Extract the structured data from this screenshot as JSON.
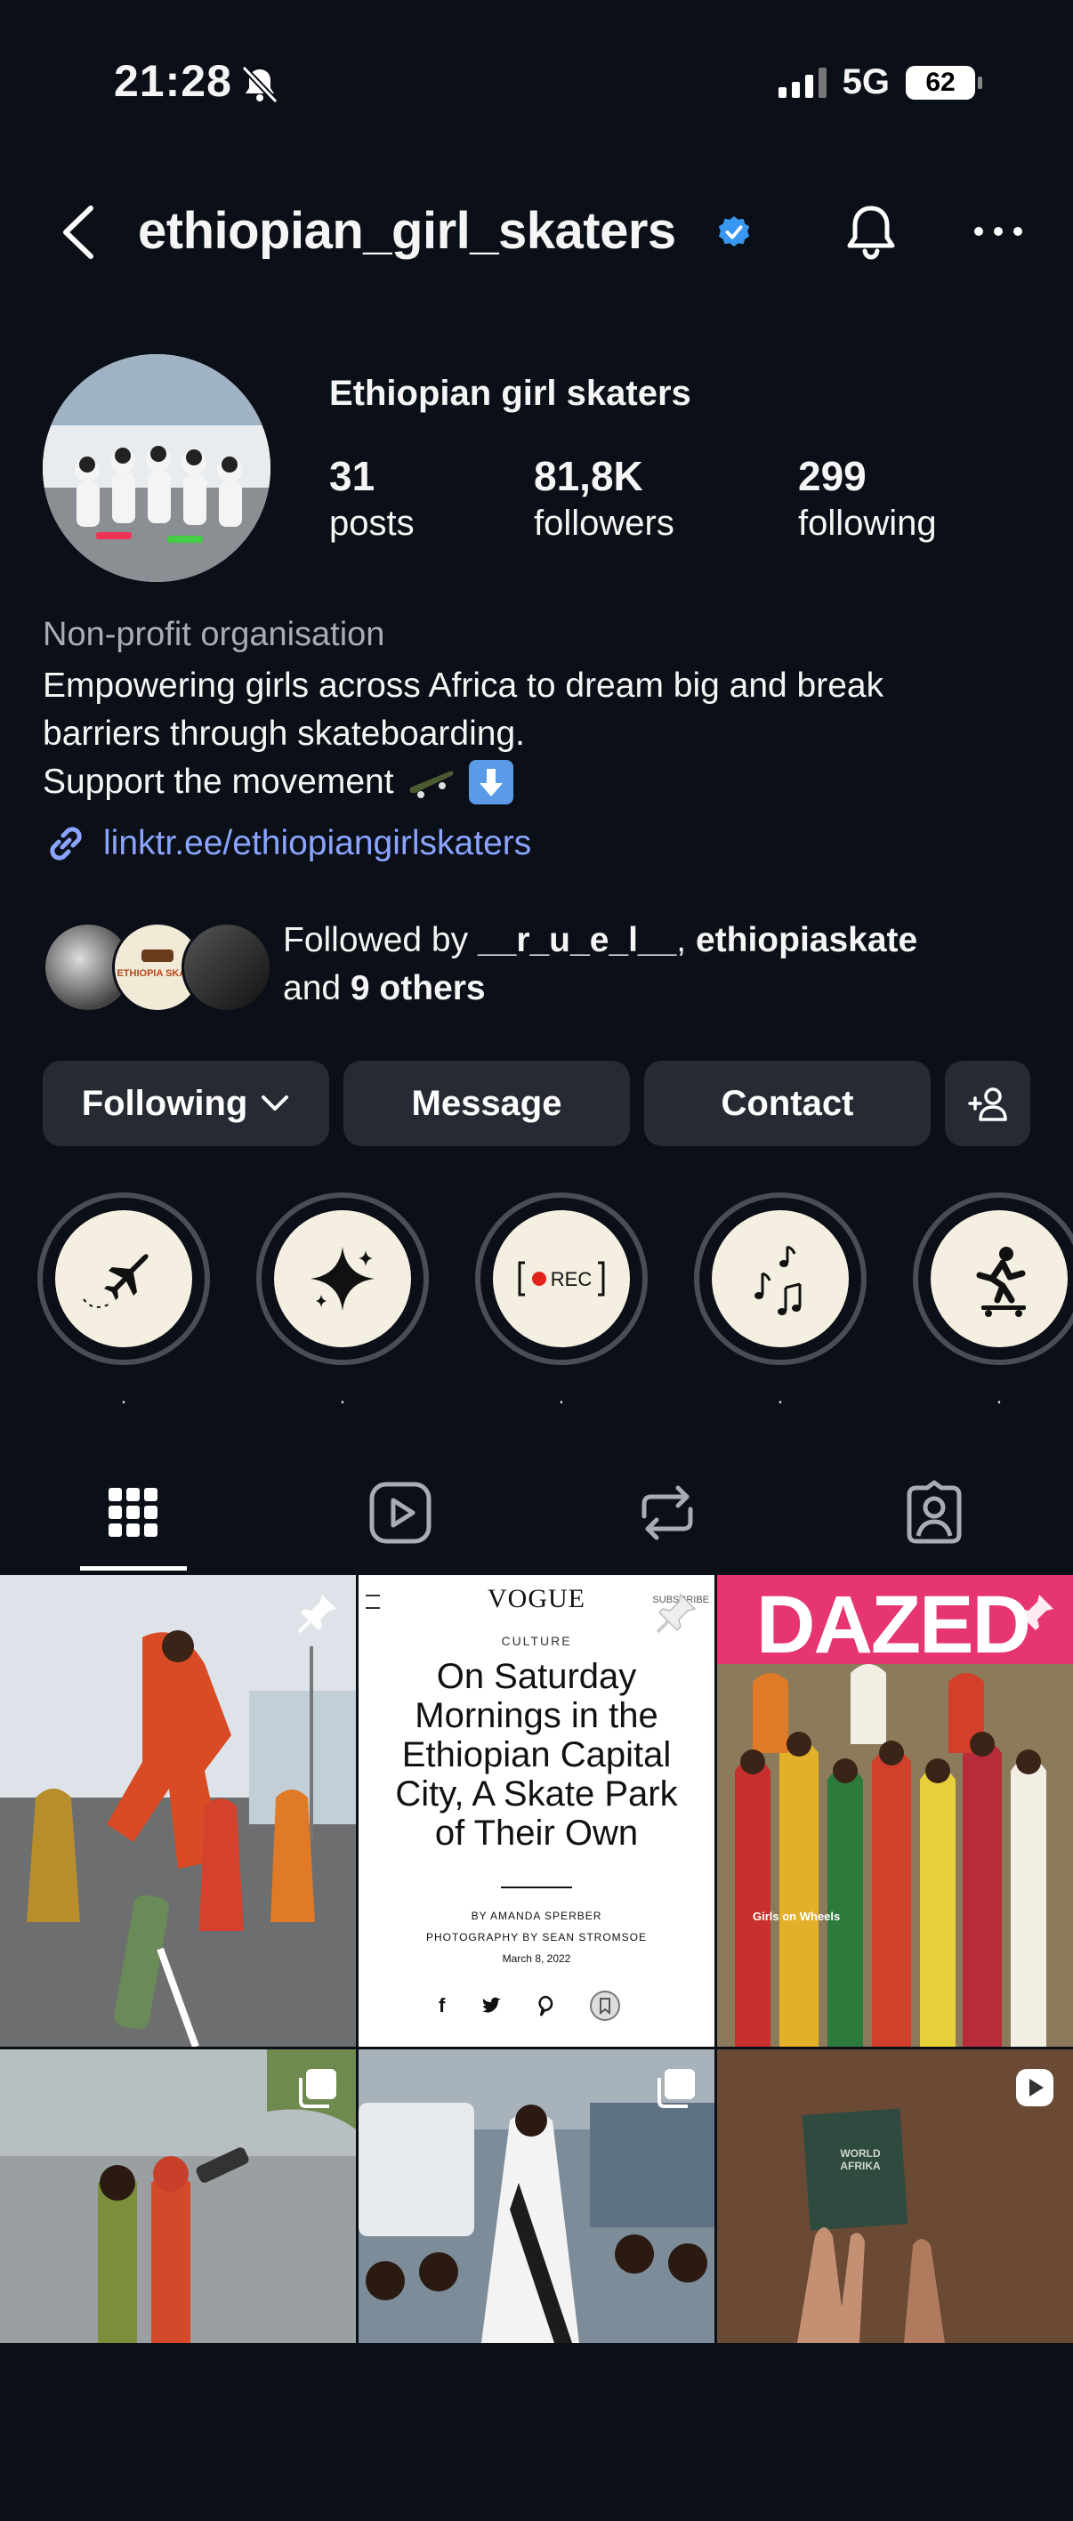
{
  "status_bar": {
    "time": "21:28",
    "network": "5G",
    "battery": "62"
  },
  "header": {
    "username": "ethiopian_girl_skaters"
  },
  "profile": {
    "display_name": "Ethiopian girl skaters",
    "stats": [
      {
        "value": "31",
        "label": "posts"
      },
      {
        "value": "81,8K",
        "label": "followers"
      },
      {
        "value": "299",
        "label": "following"
      }
    ],
    "category": "Non-profit organisation",
    "bio_line1": "Empowering girls across Africa to dream big and break",
    "bio_line2": "barriers through skateboarding.",
    "bio_line3": "Support the movement",
    "link": "linktr.ee/ethiopiangirlskaters",
    "mutual_logo_text": "ETHIOPIA SKATE",
    "followed_by_prefix": "Followed by ",
    "followed_by_user1": "__r_u_e_l__",
    "followed_by_sep": ", ",
    "followed_by_user2": "ethiopiaskate",
    "followed_by_and": "and ",
    "followed_by_others": "9 others"
  },
  "buttons": {
    "following": "Following",
    "message": "Message",
    "contact": "Contact"
  },
  "highlights": [
    {
      "icon": "airplane-icon",
      "label": "."
    },
    {
      "icon": "sparkle-icon",
      "label": "."
    },
    {
      "icon": "rec-icon",
      "icon_text": "REC",
      "label": "."
    },
    {
      "icon": "music-notes-icon",
      "label": "."
    },
    {
      "icon": "skater-icon",
      "label": "."
    }
  ],
  "tabs": [
    "grid-icon",
    "reels-icon",
    "reposts-icon",
    "tagged-icon"
  ],
  "grid": {
    "vogue": {
      "masthead": "VOGUE",
      "subscribe": "SUBSCRIBE",
      "section": "CULTURE",
      "headline": "On Saturday Mornings in the Ethiopian Capital City, A Skate Park of Their Own",
      "byline": "BY AMANDA SPERBER",
      "photo_credit": "PHOTOGRAPHY BY SEAN STROMSOE",
      "date": "March 8, 2022"
    },
    "dazed": {
      "masthead": "DAZED",
      "caption": "Girls on Wheels"
    },
    "reel_poster_text": "WORLD AFRIKA"
  },
  "colors": {
    "background": "#0b0f17",
    "button": "#262b33",
    "link": "#8aa4ff",
    "verified": "#3897f0"
  }
}
